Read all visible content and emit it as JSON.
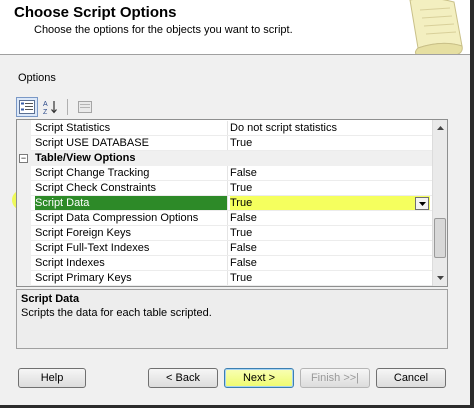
{
  "header": {
    "title": "Choose Script Options",
    "subtitle": "Choose the options for the objects you want to script."
  },
  "options_label": "Options",
  "toolbar": {
    "icons": [
      "categorized-icon",
      "alphabetical-icon",
      "property-pages-icon"
    ]
  },
  "grid": {
    "rows": [
      {
        "type": "property",
        "name": "Script Statistics",
        "value": "Do not script statistics"
      },
      {
        "type": "property",
        "name": "Script USE DATABASE",
        "value": "True"
      },
      {
        "type": "category",
        "name": "Table/View Options",
        "collapse": "−"
      },
      {
        "type": "property",
        "name": "Script Change Tracking",
        "value": "False"
      },
      {
        "type": "property",
        "name": "Script Check Constraints",
        "value": "True"
      },
      {
        "type": "property",
        "name": "Script Data",
        "value": "True",
        "selected": true
      },
      {
        "type": "property",
        "name": "Script Data Compression Options",
        "value": "False"
      },
      {
        "type": "property",
        "name": "Script Foreign Keys",
        "value": "True"
      },
      {
        "type": "property",
        "name": "Script Full-Text Indexes",
        "value": "False"
      },
      {
        "type": "property",
        "name": "Script Indexes",
        "value": "False"
      },
      {
        "type": "property",
        "name": "Script Primary Keys",
        "value": "True"
      }
    ]
  },
  "description": {
    "title": "Script Data",
    "text": "Scripts the data for each table scripted."
  },
  "buttons": {
    "help": "Help",
    "back": "< Back",
    "next": "Next >",
    "finish": "Finish >>|",
    "cancel": "Cancel"
  },
  "colors": {
    "selected_name_bg": "#2d8a28",
    "highlighter": "#eefb3e"
  }
}
